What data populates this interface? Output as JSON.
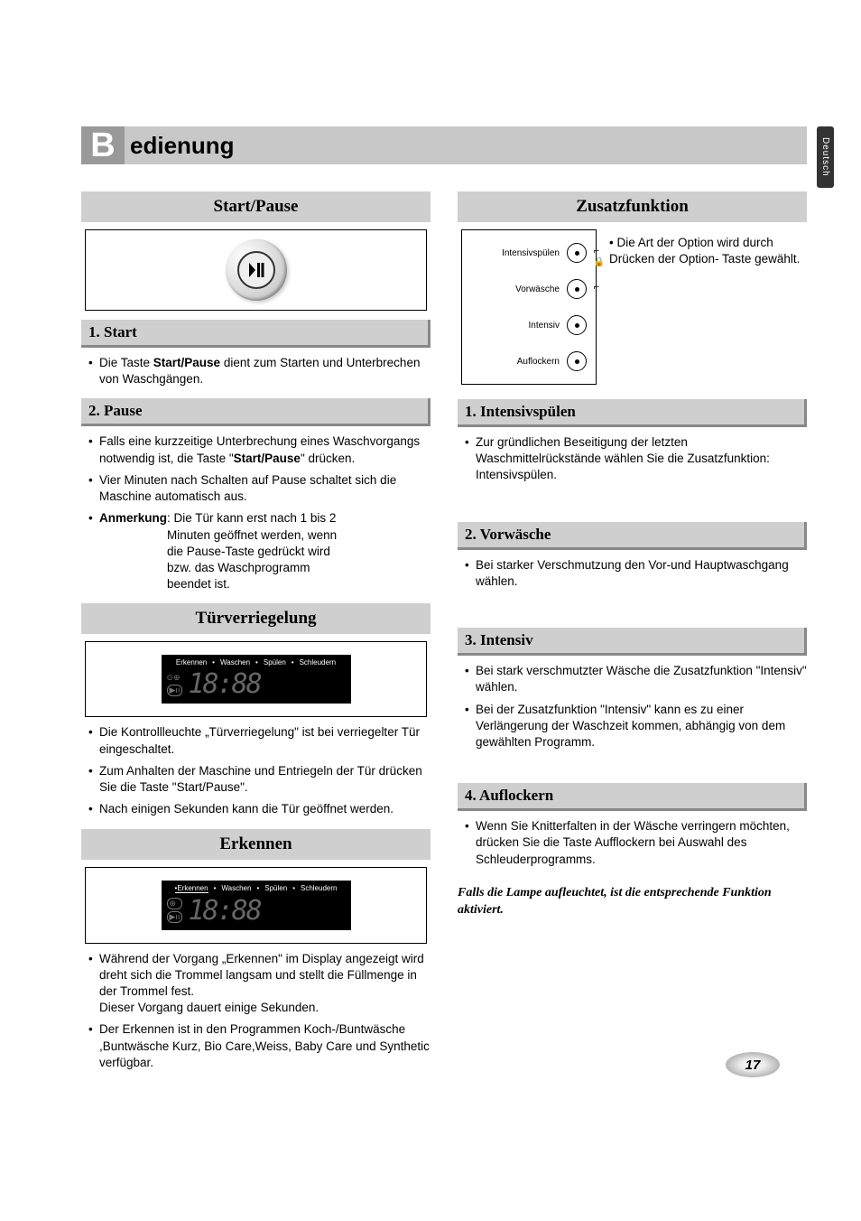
{
  "sideTab": "Deutsch",
  "title": {
    "letter": "B",
    "rest": "edienung"
  },
  "pageNumber": "17",
  "left": {
    "h_startPause": "Start/Pause",
    "h_start": "1. Start",
    "start_bullets": [
      "Die Taste <b>Start/Pause</b> dient zum Starten und Unterbrechen von Waschgängen."
    ],
    "h_pause": "2. Pause",
    "pause_bullets": [
      "Falls eine kurzzeitige Unterbrechung eines Waschvorgangs notwendig ist, die Taste \"<b>Start/Pause</b>\" drücken.",
      "Vier Minuten nach Schalten auf Pause schaltet sich die Maschine automatisch aus."
    ],
    "pause_note_label": "Anmerkung",
    "pause_note": ": Die Tür kann erst nach 1 bis 2 Minuten geöffnet werden, wenn die Pause-Taste gedrückt wird bzw. das Waschprogramm beendet ist.",
    "h_tuer": "Türverriegelung",
    "display_labels": [
      "Erkennen",
      "Waschen",
      "Spülen",
      "Schleudern"
    ],
    "display_time": "18:88",
    "tuer_bullets": [
      "Die Kontrollleuchte „Türverriegelung\" ist bei verriegelter Tür eingeschaltet.",
      "Zum Anhalten der Maschine und Entriegeln der Tür drücken Sie die Taste \"Start/Pause\".",
      "Nach einigen Sekunden kann die Tür geöffnet werden."
    ],
    "h_erkennen": "Erkennen",
    "erkennen_bullets": [
      "Während der Vorgang „Erkennen\" im Display angezeigt wird dreht sich die Trommel langsam und stellt die Füllmenge in der Trommel fest.<br>Dieser Vorgang dauert einige Sekunden.",
      "Der Erkennen ist in den Programmen Koch-/Buntwäsche ,Buntwäsche Kurz, Bio Care,Weiss, Baby Care  und Synthetic verfügbar."
    ]
  },
  "right": {
    "h_zusatz": "Zusatzfunktion",
    "options": [
      "Intensivspülen",
      "Vorwäsche",
      "Intensiv",
      "Auflockern"
    ],
    "zusatz_text": "Die Art der Option wird durch Drücken der Option- Taste gewählt.",
    "h_intensivsp": "1. Intensivspülen",
    "intensivsp_bullets": [
      "Zur gründlichen Beseitigung der letzten Waschmittelrückstände wählen Sie die Zusatzfunktion: Intensivspülen."
    ],
    "h_vorwaesche": "2. Vorwäsche",
    "vorwaesche_bullets": [
      "Bei starker Verschmutzung den Vor-und Hauptwaschgang wählen."
    ],
    "h_intensiv": "3. Intensiv",
    "intensiv_bullets": [
      "Bei stark verschmutzter Wäsche die Zusatzfunktion \"Intensiv\" wählen.",
      "Bei der Zusatzfunktion \"Intensiv\" kann es zu einer Verlängerung der Waschzeit kommen, abhängig von dem gewählten Programm."
    ],
    "h_auflockern": "4. Auflockern",
    "auflockern_bullets": [
      "Wenn Sie Knitterfalten in der Wäsche verringern möchten, drücken Sie die Taste Aufflockern bei Auswahl des Schleuderprogramms."
    ],
    "italic_note": "Falls die Lampe aufleuchtet, ist die entsprechende Funktion aktiviert."
  }
}
